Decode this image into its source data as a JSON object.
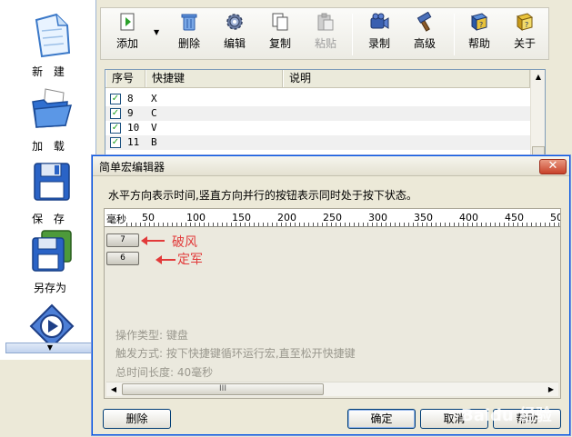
{
  "sidebar": {
    "items": [
      {
        "label": "新 建",
        "icon": "new-document-icon"
      },
      {
        "label": "加 载",
        "icon": "open-folder-icon"
      },
      {
        "label": "保 存",
        "icon": "save-disk-icon"
      },
      {
        "label": "另存为",
        "icon": "save-as-disk-icon"
      },
      {
        "label": "",
        "icon": "play-icon"
      }
    ],
    "scroll_down_glyph": "▼"
  },
  "toolbar": {
    "add": "添加",
    "dropdown_glyph": "▼",
    "delete": "删除",
    "edit": "编辑",
    "copy": "复制",
    "paste": "粘贴",
    "record": "录制",
    "advanced": "高级",
    "help": "帮助",
    "about": "关于"
  },
  "list": {
    "columns": [
      "序号",
      "快捷键",
      "说明"
    ],
    "rows": [
      {
        "checked": true,
        "no": "8",
        "key": "X",
        "desc": ""
      },
      {
        "checked": true,
        "no": "9",
        "key": "C",
        "desc": ""
      },
      {
        "checked": true,
        "no": "10",
        "key": "V",
        "desc": ""
      },
      {
        "checked": true,
        "no": "11",
        "key": "B",
        "desc": ""
      }
    ],
    "check_glyph": "✓",
    "scroll_up_glyph": "▲"
  },
  "dialog": {
    "title": "简单宏编辑器",
    "close_glyph": "✕",
    "description": "水平方向表示时间,竖直方向并行的按钮表示同时处于按下状态。",
    "ruler": {
      "unit": "毫秒",
      "labels": [
        "50",
        "100",
        "150",
        "200",
        "250",
        "300",
        "350",
        "400",
        "450",
        "50"
      ]
    },
    "keys": [
      {
        "label": "7",
        "annotation": "破风"
      },
      {
        "label": "6",
        "annotation": "定军"
      }
    ],
    "info": {
      "op_type": "操作类型:  键盘",
      "trigger": "触发方式:  按下快捷键循环运行宏,直至松开快捷键",
      "total": "总时间长度:  40毫秒"
    },
    "hscroll": {
      "left": "◀",
      "right": "▶",
      "thumb": "III"
    },
    "buttons": {
      "delete": "删除",
      "ok": "确定",
      "cancel": "取消",
      "help": "帮助"
    }
  },
  "watermark": "Baidu 经验",
  "colors": {
    "accent": "#0054e3",
    "annotation": "#e23a3a",
    "bg": "#ece9d8"
  }
}
